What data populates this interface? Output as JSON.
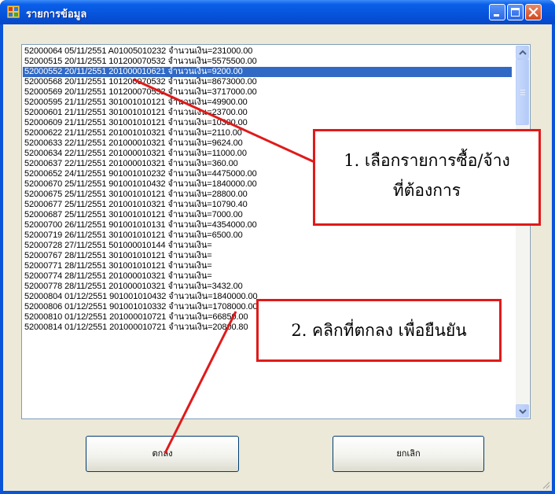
{
  "window": {
    "title": "รายการข้อมูล"
  },
  "list": {
    "selected_index": 2,
    "rows": [
      "52000064 05/11/2551 A01005010232 จำนวนเงิน=231000.00",
      "52000515 20/11/2551 101200070532 จำนวนเงิน=5575500.00",
      "52000552 20/11/2551 201000010621 จำนวนเงิน=9200.00",
      "52000568 20/11/2551 101200070532 จำนวนเงิน=8673000.00",
      "52000569 20/11/2551 101200070532 จำนวนเงิน=3717000.00",
      "52000595 21/11/2551 301001010121 จำนวนเงิน=49900.00",
      "52000601 21/11/2551 301001010121 จำนวนเงิน=23700.00",
      "52000609 21/11/2551 301001010121 จำนวนเงิน=10300.00",
      "52000622 21/11/2551 201001010321 จำนวนเงิน=2110.00",
      "52000633 22/11/2551 201000010321 จำนวนเงิน=9624.00",
      "52000634 22/11/2551 201000010321 จำนวนเงิน=11000.00",
      "52000637 22/11/2551 201000010321 จำนวนเงิน=360.00",
      "52000652 24/11/2551 901001010232 จำนวนเงิน=4475000.00",
      "52000670 25/11/2551 901001010432 จำนวนเงิน=1840000.00",
      "52000675 25/11/2551 301001010121 จำนวนเงิน=28800.00",
      "52000677 25/11/2551 201001010321 จำนวนเงิน=10790.40",
      "52000687 25/11/2551 301001010121 จำนวนเงิน=7000.00",
      "52000700 26/11/2551 901001010131 จำนวนเงิน=4354000.00",
      "52000719 26/11/2551 301001010121 จำนวนเงิน=6500.00",
      "52000728 27/11/2551 501000010144 จำนวนเงิน=",
      "52000767 28/11/2551 301001010121 จำนวนเงิน=",
      "52000771 28/11/2551 301001010121 จำนวนเงิน=",
      "52000774 28/11/2551 201000010321 จำนวนเงิน=",
      "52000778 28/11/2551 201000010321 จำนวนเงิน=3432.00",
      "52000804 01/12/2551 901001010432 จำนวนเงิน=1840000.00",
      "52000806 01/12/2551 901001010332 จำนวนเงิน=1708000.00",
      "52000810 01/12/2551 201000010721 จำนวนเงิน=66850.00",
      "52000814 01/12/2551 201000010721 จำนวนเงิน=20800.80"
    ],
    "scroll_position": 0.0
  },
  "buttons": {
    "ok_label": "ตกลง",
    "cancel_label": "ยกเลิก"
  },
  "callouts": {
    "step1_line1": "1. เลือกรายการซื้อ/จ้าง",
    "step1_line2": "ที่ต้องการ",
    "step2": "2. คลิกที่ตกลง เพื่อยืนยัน"
  },
  "colors": {
    "selection": "#316ac5",
    "callout_border": "#e01a1a",
    "titlebar": "#0755dd"
  }
}
